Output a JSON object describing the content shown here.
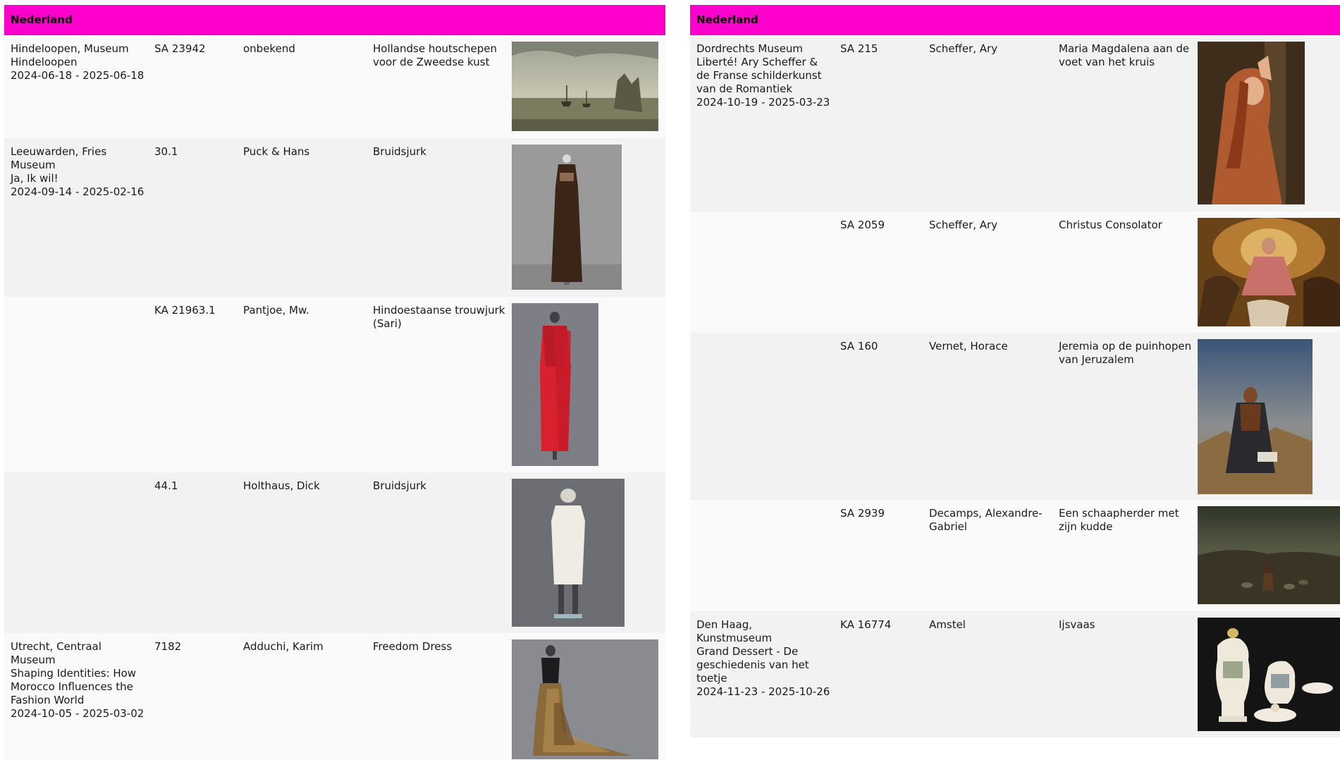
{
  "left": {
    "header": "Nederland",
    "rows": [
      {
        "location": "Hindeloopen, Museum Hindeloopen\n2024-06-18 - 2025-06-18",
        "number": "SA 23942",
        "maker": "onbekend",
        "title": "Hollandse houtschepen voor de Zweedse kust",
        "image": "painting-ships-coast"
      },
      {
        "location": "Leeuwarden, Fries Museum\nJa, Ik wil!\n2024-09-14 - 2025-02-16",
        "number": "30.1",
        "maker": "Puck & Hans",
        "title": "Bruidsjurk",
        "image": "brown-wedding-dress"
      },
      {
        "location": "",
        "number": "KA 21963.1",
        "maker": "Pantjoe, Mw.",
        "title": "Hindoestaanse trouwjurk (Sari)",
        "image": "red-sari"
      },
      {
        "location": "",
        "number": "44.1",
        "maker": "Holthaus, Dick",
        "title": "Bruidsjurk",
        "image": "white-coat-dress"
      },
      {
        "location": "Utrecht, Centraal Museum\nShaping Identities: How Morocco Influences the Fashion World\n2024-10-05 - 2025-03-02",
        "number": "7182",
        "maker": "Adduchi, Karim",
        "title": "Freedom Dress",
        "image": "freedom-dress"
      }
    ]
  },
  "right": {
    "header": "Nederland",
    "rows": [
      {
        "location": "Dordrechts Museum\nLiberté! Ary Scheffer & de Franse schilderkunst van de Romantiek\n2024-10-19 - 2025-03-23",
        "number": "SA 215",
        "maker": "Scheffer, Ary",
        "title": "Maria Magdalena aan de voet van het kruis",
        "image": "painting-magdalene"
      },
      {
        "location": "",
        "number": "SA 2059",
        "maker": "Scheffer, Ary",
        "title": "Christus Consolator",
        "image": "painting-christ-consolator"
      },
      {
        "location": "",
        "number": "SA 160",
        "maker": "Vernet, Horace",
        "title": "Jeremia op de puinhopen van Jeruzalem",
        "image": "painting-jeremiah"
      },
      {
        "location": "",
        "number": "SA 2939",
        "maker": "Decamps, Alexandre-Gabriel",
        "title": "Een schaapherder met zijn kudde",
        "image": "painting-shepherd"
      },
      {
        "location": "Den Haag, Kunstmuseum\nGrand Dessert - De geschiedenis van het toetje\n2024-11-23 - 2025-10-26",
        "number": "KA 16774",
        "maker": "Amstel",
        "title": "Ijsvaas",
        "image": "porcelain-ice-vase"
      }
    ]
  }
}
